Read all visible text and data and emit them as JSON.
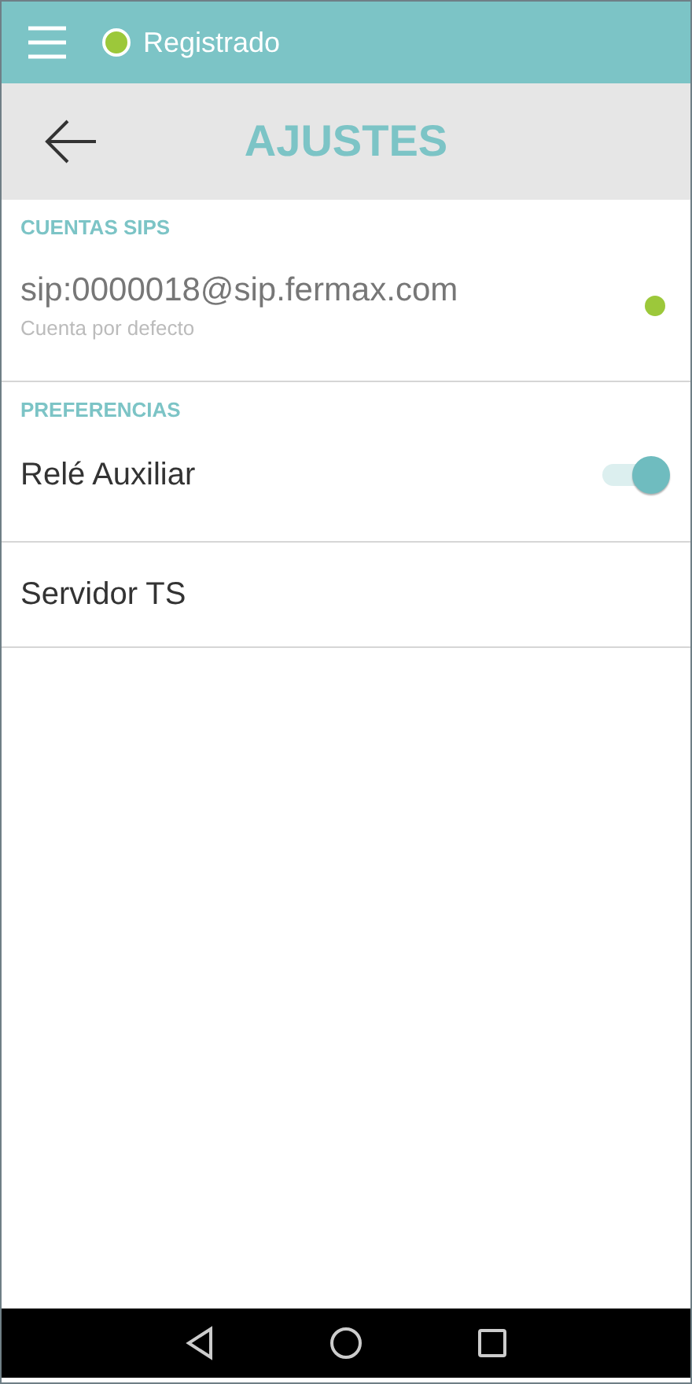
{
  "top_bar": {
    "status": {
      "label": "Registrado",
      "color": "#9cc83a"
    }
  },
  "header": {
    "title": "AJUSTES"
  },
  "sections": [
    {
      "title": "CUENTAS SIPS",
      "items": [
        {
          "kind": "account",
          "label": "sip:0000018@sip.fermax.com",
          "subtitle": "Cuenta por defecto",
          "color": "#9cc83a"
        }
      ]
    },
    {
      "title": "PREFERENCIAS",
      "items": [
        {
          "kind": "toggle",
          "label": "Relé Auxiliar",
          "on": true
        },
        {
          "kind": "plain",
          "label": "Servidor TS"
        }
      ]
    }
  ]
}
